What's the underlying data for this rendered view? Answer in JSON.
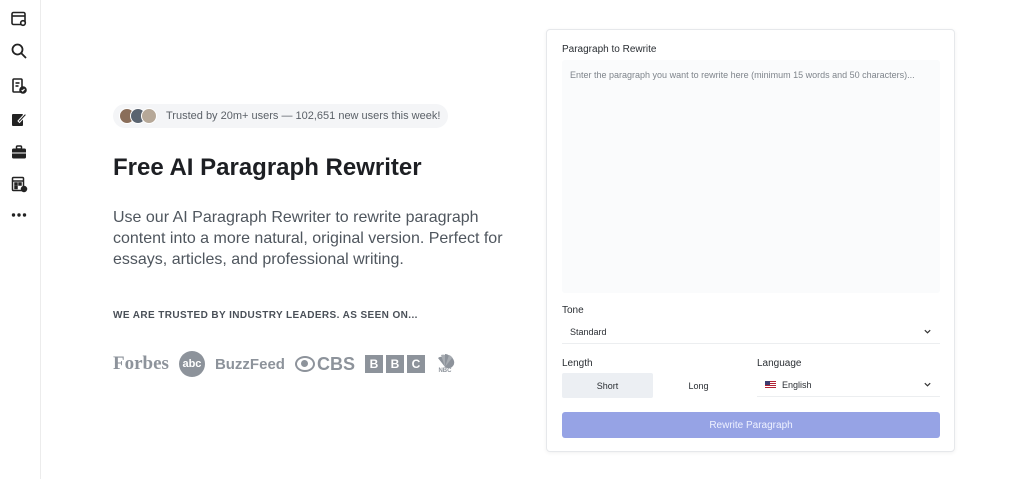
{
  "sidebar": {
    "icons": [
      "browser-window-icon",
      "search-zoom-icon",
      "document-check-icon",
      "edit-pen-icon",
      "briefcase-icon",
      "calendar-grid-icon",
      "more-dots-icon"
    ]
  },
  "hero": {
    "trust_text": "Trusted by 20m+ users — 102,651 new users this week!",
    "title": "Free AI Paragraph Rewriter",
    "description": "Use our AI Paragraph Rewriter to rewrite paragraph content into a more natural, original version. Perfect for essays, articles, and professional writing.",
    "leaders_heading": "WE ARE TRUSTED BY INDUSTRY LEADERS. AS SEEN ON...",
    "logos": {
      "forbes": "Forbes",
      "abc": "abc",
      "buzzfeed": "BuzzFeed",
      "cbs": "CBS",
      "bbc": [
        "B",
        "B",
        "C"
      ],
      "nbc": "NBC"
    }
  },
  "form": {
    "paragraph_label": "Paragraph to Rewrite",
    "paragraph_placeholder": "Enter the paragraph you want to rewrite here (minimum 15 words and 50 characters)...",
    "tone_label": "Tone",
    "tone_value": "Standard",
    "length_label": "Length",
    "length_options": [
      "Short",
      "Long"
    ],
    "length_selected": "Short",
    "language_label": "Language",
    "language_value": "English",
    "submit_label": "Rewrite Paragraph"
  },
  "colors": {
    "accent_button": "#96a3e5",
    "logo_gray": "#8d939b"
  }
}
